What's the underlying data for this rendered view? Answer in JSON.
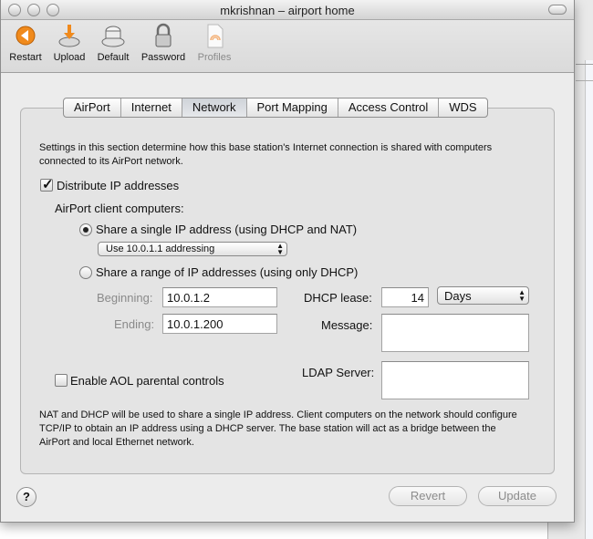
{
  "window": {
    "title": "mkrishnan – airport home"
  },
  "toolbar": {
    "items": [
      {
        "label": "Restart",
        "icon": "restart-icon"
      },
      {
        "label": "Upload",
        "icon": "upload-icon"
      },
      {
        "label": "Default",
        "icon": "default-icon"
      },
      {
        "label": "Password",
        "icon": "lock-icon"
      },
      {
        "label": "Profiles",
        "icon": "profiles-icon",
        "enabled": false
      }
    ]
  },
  "tabs": [
    "AirPort",
    "Internet",
    "Network",
    "Port Mapping",
    "Access Control",
    "WDS"
  ],
  "selected_tab": "Network",
  "network": {
    "description": "Settings in this section determine how this base station's Internet connection is shared with computers connected to its AirPort network.",
    "distribute_label": "Distribute IP addresses",
    "distribute_checked": true,
    "client_label": "AirPort client computers:",
    "share_single_label": "Share a single IP address (using DHCP and NAT)",
    "share_single_selected": true,
    "addressing_option": "Use 10.0.1.1 addressing",
    "share_range_label": "Share a range of IP addresses (using only DHCP)",
    "share_range_selected": false,
    "beginning_label": "Beginning:",
    "beginning_value": "10.0.1.2",
    "ending_label": "Ending:",
    "ending_value": "10.0.1.200",
    "dhcp_lease_label": "DHCP lease:",
    "dhcp_lease_value": "14",
    "dhcp_lease_unit": "Days",
    "message_label": "Message:",
    "message_value": "",
    "aol_label": "Enable AOL parental controls",
    "aol_checked": false,
    "ldap_label": "LDAP Server:",
    "ldap_value": "",
    "footer_note": "NAT and DHCP will be used to share a single IP address. Client computers on the network should configure TCP/IP to obtain an IP address using a DHCP server. The base station will act as a bridge between the AirPort and local Ethernet network."
  },
  "buttons": {
    "help": "?",
    "revert": "Revert",
    "update": "Update"
  },
  "colors": {
    "accent_orange": "#f08a1c",
    "window_bg": "#ececec"
  }
}
